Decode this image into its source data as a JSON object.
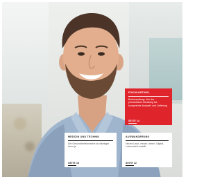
{
  "cards": {
    "featured": {
      "kicker": "FOKUSARTIKEL",
      "body": "Buchhandlung: Von der persönlichen Beratung bis kompetente Auswahl und Lieferung",
      "page": "SEITE 14"
    },
    "left": {
      "kicker": "MEDIZIN UND TECHNIK",
      "body": "Die Gesundheitsbranche ist wichtiger denn je",
      "page": "SEITE 18"
    },
    "right": {
      "kicker": "AUSWANDERUNG",
      "body": "Neues Land, neues Leben: Digital-Lebenslauf erstellt",
      "page": "SEITE 22"
    }
  },
  "colors": {
    "accent": "#e0242b",
    "card_white": "#ffffff",
    "shirt": "#9fb4cd"
  },
  "image": {
    "subject": "smiling bearded man in light blue shirt, blurred office background"
  }
}
